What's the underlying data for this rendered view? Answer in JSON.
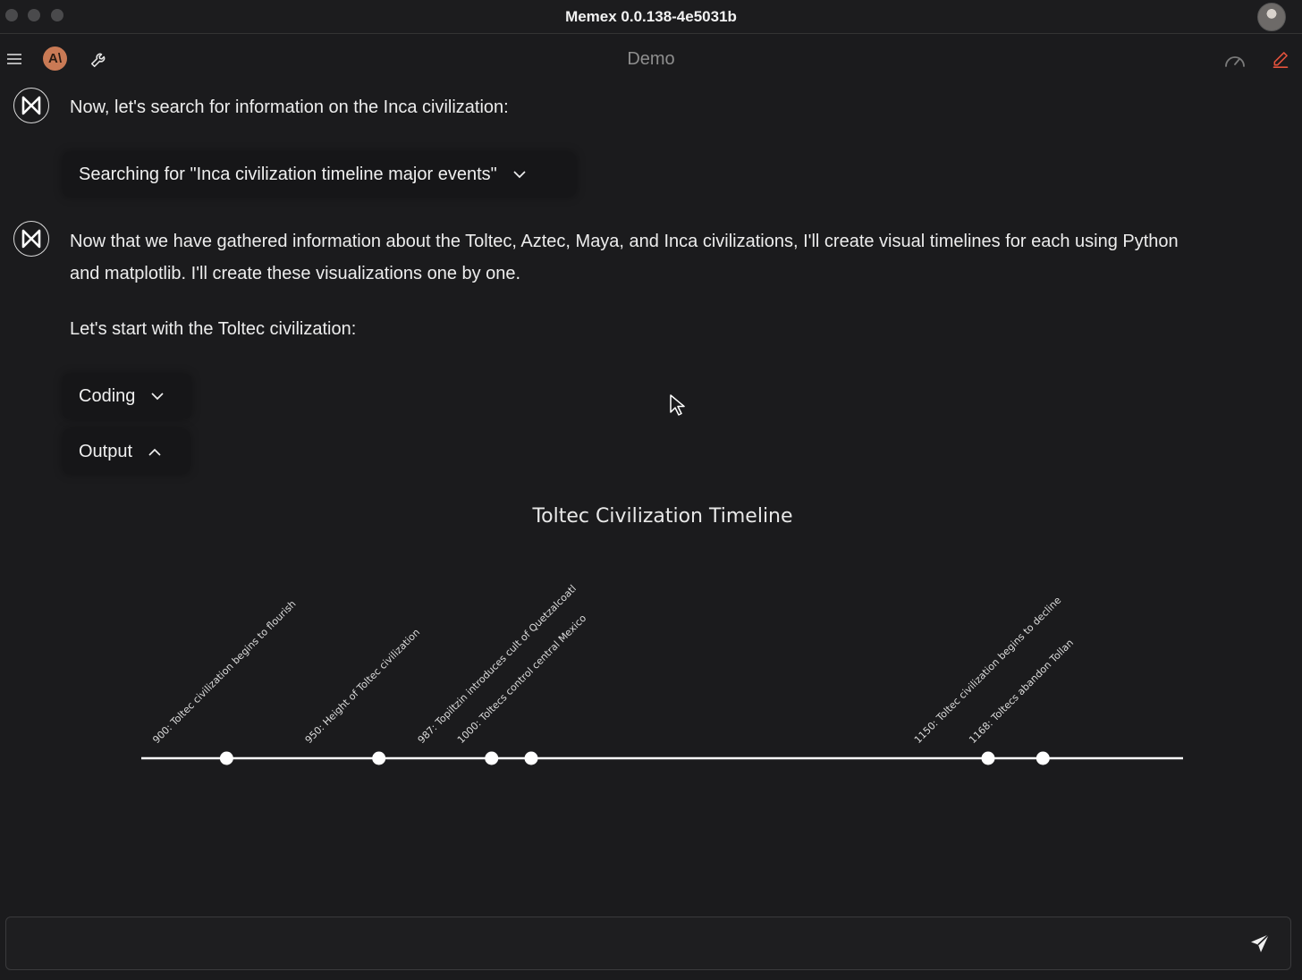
{
  "window": {
    "title": "Memex 0.0.138-4e5031b"
  },
  "toolbar": {
    "title": "Demo",
    "anthropic_badge": "A\\"
  },
  "messages": {
    "m1": {
      "text": "Now, let's search for information on the Inca civilization:"
    },
    "search_pill": {
      "label": "Searching for \"Inca civilization timeline major events\"",
      "icon": "chevron-down-icon"
    },
    "m2": {
      "line1": "Now that we have gathered information about the Toltec, Aztec, Maya, and Inca civilizations, I'll create visual timelines for each using Python",
      "line2": "and matplotlib. I'll create these visualizations one by one.",
      "line3": "Let's start with the Toltec civilization:"
    },
    "coding_pill": {
      "label": "Coding",
      "icon": "chevron-down-icon"
    },
    "output_pill": {
      "label": "Output",
      "icon": "chevron-up-icon"
    }
  },
  "chart_data": {
    "type": "scatter",
    "title": "Toltec Civilization Timeline",
    "xlabel": "",
    "ylabel": "",
    "xlim": [
      872,
      1214
    ],
    "grid": false,
    "events": [
      {
        "year": 900,
        "label": "900: Toltec civilization begins to flourish"
      },
      {
        "year": 950,
        "label": "950: Height of Toltec civilization"
      },
      {
        "year": 987,
        "label": "987: Topiltzin introduces cult of Quetzalcoatl"
      },
      {
        "year": 1000,
        "label": "1000: Toltecs control central Mexico"
      },
      {
        "year": 1150,
        "label": "1150: Toltec civilization begins to decline"
      },
      {
        "year": 1168,
        "label": "1168: Toltecs abandon Tollan"
      }
    ],
    "colors": {
      "line": "#ffffff",
      "points": "#ffffff",
      "text": "#dcdcdc",
      "background": "#1b1b1d"
    }
  },
  "input": {
    "placeholder": ""
  }
}
